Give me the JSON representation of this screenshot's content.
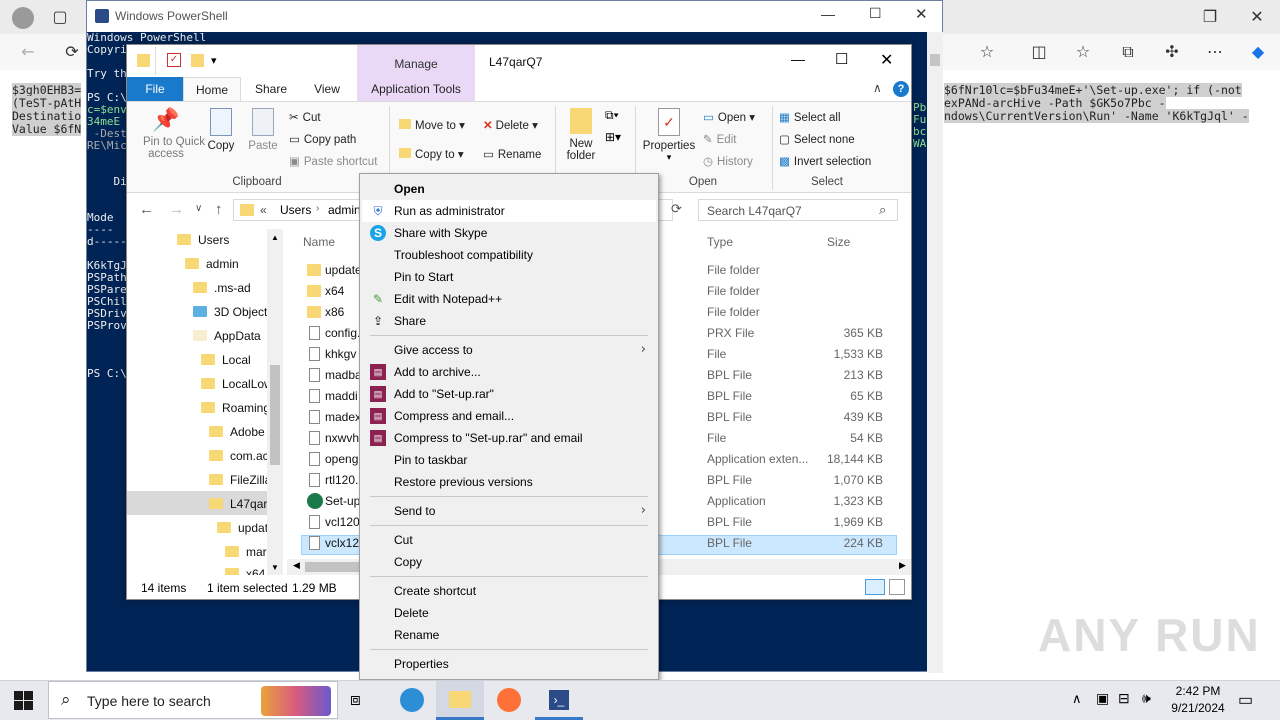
{
  "powershell": {
    "title": "Windows PowerShell",
    "lines_left": [
      "Windows PowerShell",
      "Copyri",
      "",
      "Try th",
      "",
      "PS C:\\",
      "c=$env",
      "34meE",
      " -Dest",
      "RE\\Mic",
      "",
      "",
      "    Di",
      "",
      "",
      "Mode",
      "----",
      "d-----",
      "",
      "K6kTgJ",
      "PSPath",
      "PSPare",
      "PSChil",
      "PSDriv",
      "PSProv",
      "",
      "",
      "",
      "PS C:\\"
    ],
    "lines_right": [
      "Pb",
      "Fu",
      "bc",
      "WA"
    ]
  },
  "background_code": {
    "left": [
      "$3gh0EHB3=",
      "(TeST-pAtH",
      "Destinatio",
      "Value $6fN"
    ],
    "right": [
      "$6fNr10lc=$bFu34meE+'\\Set-up.exe'; if (-not",
      "exPANd-arcHive -Path $GK5o7Pbc -",
      "ndows\\CurrentVersion\\Run' -Name 'K6kTgJql' -",
      ""
    ]
  },
  "explorer": {
    "title": "L47qarQ7",
    "manage_label": "Manage",
    "tabs": [
      "File",
      "Home",
      "Share",
      "View",
      "Application Tools"
    ],
    "ribbon": {
      "pin_quick": "Pin to Quick access",
      "pin_line1": "Pin to Quick",
      "pin_line2": "access",
      "copy": "Copy",
      "paste": "Paste",
      "cut": "Cut",
      "copy_path": "Copy path",
      "paste_shortcut": "Paste shortcut",
      "clipboard": "Clipboard",
      "move_to": "Move to",
      "copy_to": "Copy to",
      "delete": "Delete",
      "rename": "Rename",
      "new_folder_1": "New",
      "new_folder_2": "folder",
      "properties": "Properties",
      "open": "Open",
      "edit": "Edit",
      "history": "History",
      "open_group": "Open",
      "select_all": "Select all",
      "select_none": "Select none",
      "invert_selection": "Invert selection",
      "select_group": "Select"
    },
    "address": {
      "prefix": "«",
      "crumb1": "Users",
      "crumb2": "admin",
      "search_placeholder": "Search L47qarQ7"
    },
    "nav_items": [
      "Users",
      "admin",
      ".ms-ad",
      "3D Object",
      "AppData",
      "Local",
      "LocalLow",
      "Roaming",
      "Adobe",
      "com.ac",
      "FileZilla",
      "L47qarQ",
      "updat",
      "mar",
      "x64"
    ],
    "columns": {
      "name": "Name",
      "type": "Type",
      "size": "Size"
    },
    "files": [
      {
        "name": "update",
        "type": "File folder",
        "size": ""
      },
      {
        "name": "x64",
        "type": "File folder",
        "size": ""
      },
      {
        "name": "x86",
        "type": "File folder",
        "size": ""
      },
      {
        "name": "config.",
        "type": "PRX File",
        "size": "365 KB"
      },
      {
        "name": "khkgv",
        "type": "File",
        "size": "1,533 KB"
      },
      {
        "name": "madba",
        "type": "BPL File",
        "size": "213 KB"
      },
      {
        "name": "maddi",
        "type": "BPL File",
        "size": "65 KB"
      },
      {
        "name": "madex",
        "type": "BPL File",
        "size": "439 KB"
      },
      {
        "name": "nxwvh",
        "type": "File",
        "size": "54 KB"
      },
      {
        "name": "opengl",
        "type": "Application exten...",
        "size": "18,144 KB"
      },
      {
        "name": "rtl120.b",
        "type": "BPL File",
        "size": "1,070 KB"
      },
      {
        "name": "Set-up",
        "type": "Application",
        "size": "1,323 KB"
      },
      {
        "name": "vcl120.",
        "type": "BPL File",
        "size": "1,969 KB"
      },
      {
        "name": "vclx120",
        "type": "BPL File",
        "size": "224 KB"
      }
    ],
    "status": {
      "items": "14 items",
      "selected": "1 item selected",
      "size": "1.29 MB"
    }
  },
  "context_menu": {
    "items": [
      "Open",
      "Run as administrator",
      "Share with Skype",
      "Troubleshoot compatibility",
      "Pin to Start",
      "Edit with Notepad++",
      "Share",
      "Give access to",
      "Add to archive...",
      "Add to \"Set-up.rar\"",
      "Compress and email...",
      "Compress to \"Set-up.rar\" and email",
      "Pin to taskbar",
      "Restore previous versions",
      "Send to",
      "Cut",
      "Copy",
      "Create shortcut",
      "Delete",
      "Rename",
      "Properties"
    ]
  },
  "taskbar": {
    "search_placeholder": "Type here to search",
    "time": "2:42 PM",
    "date": "9/21/2024"
  },
  "watermark": "ANY RUN",
  "colors": {
    "ps_bg": "#012456",
    "accent": "#1979ca",
    "selected": "#cce8ff",
    "manage_tab": "#e9d9f6"
  }
}
